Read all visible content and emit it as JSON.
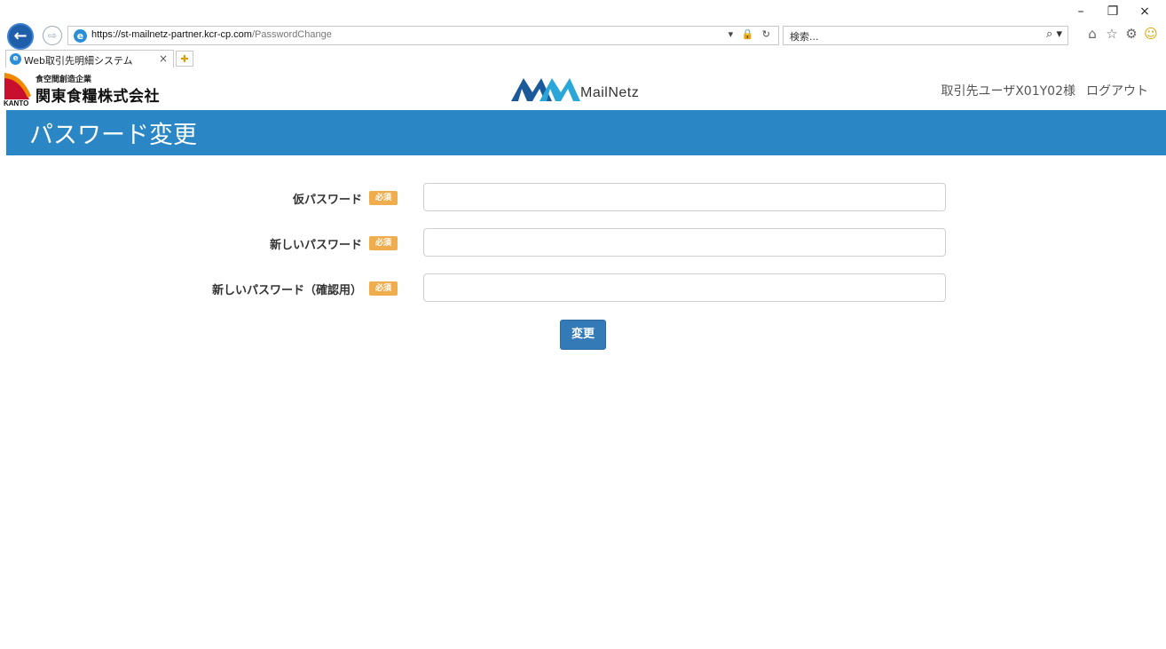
{
  "browser": {
    "window_controls": {
      "minimize": "–",
      "restore": "❐",
      "close": "×"
    },
    "back_icon": "←",
    "forward_icon": "⇨",
    "url_prefix": "https://st-mailnetz-partner.",
    "url_domain": "kcr-cp.com",
    "url_path": "/PasswordChange",
    "address_tools": "▾ 🔒 ↻",
    "search_placeholder": "検索...",
    "search_icon": "⌕ ▾",
    "tab_title": "Web取引先明細システム",
    "tab_close": "×",
    "new_tab_icon": "✚",
    "toolbar_icons": [
      "home-icon",
      "favorites-star-icon",
      "settings-gear-icon",
      "feedback-smiley-icon"
    ]
  },
  "header": {
    "company_tagline": "食空間創造企業",
    "company_name": "関東食糧株式会社",
    "company_logo_text": "KANTO",
    "brand_name": "MailNetz",
    "brand_colors": [
      "#1a5a9a",
      "#2aa7d8"
    ],
    "user_label": "取引先ユーザX01Y02様",
    "logout_label": "ログアウト"
  },
  "page": {
    "title": "パスワード変更",
    "title_bar_color": "#2a86c5"
  },
  "form": {
    "required_badge": "必須",
    "fields": [
      {
        "label": "仮パスワード",
        "value": ""
      },
      {
        "label": "新しいパスワード",
        "value": ""
      },
      {
        "label": "新しいパスワード（確認用）",
        "value": ""
      }
    ],
    "submit_label": "変更"
  }
}
